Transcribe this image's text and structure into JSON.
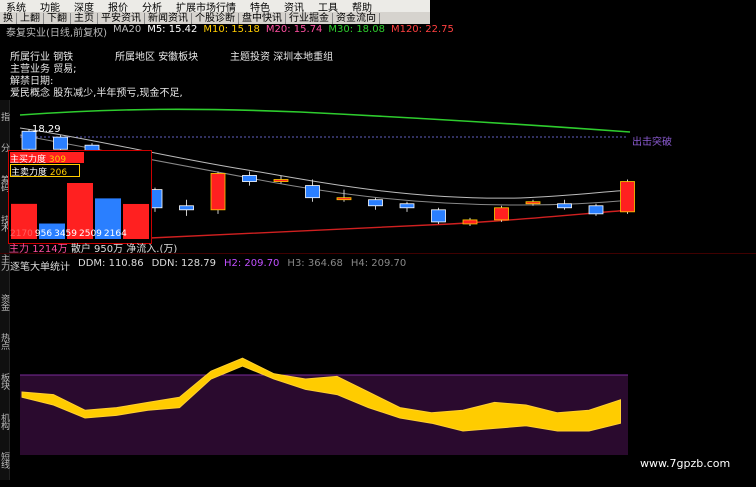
{
  "menu": [
    "系统",
    "功能",
    "深度",
    "报价",
    "分析",
    "扩展市场行情",
    "特色",
    "资讯",
    "工具",
    "帮助"
  ],
  "toolbar": [
    "换",
    "上翻",
    "下翻",
    "主页",
    "平安资讯",
    "新闻资讯",
    "个股诊断",
    "盘中快讯",
    "行业掘金",
    "资金流向"
  ],
  "header": {
    "stock": "泰复实业(日线,前复权)",
    "ma_label": "MA20",
    "m5": "M5: 15.42",
    "m10": "M10: 15.18",
    "m20": "M20: 15.74",
    "m30": "M30: 18.08",
    "m120": "M120: 22.75"
  },
  "stock_info": {
    "industry_label": "所属行业",
    "industry": "钢铁",
    "region_label": "所属地区",
    "region": "安徽板块",
    "theme_label": "主题投资",
    "theme": "深圳本地重组",
    "business_label": "主营业务",
    "business": "贸易;",
    "unlock_label": "解禁日期:",
    "concept_label": "爱民概念",
    "concept": "股东减少,半年预亏,现金不足,"
  },
  "price_label": "18.29",
  "signal_label": "出击突破",
  "force_panel": {
    "buy_label": "主买力度",
    "buy_value": "309",
    "sell_label": "主卖力度",
    "sell_value": "206",
    "bars": [
      "2170",
      "956",
      "3459",
      "2509",
      "2164"
    ],
    "bar_values": [
      2170,
      956,
      3459,
      2509,
      2164
    ],
    "main_label": "主力",
    "main_value": "1214万",
    "retail_label": "散户",
    "retail_value": "950万",
    "net_label": "净流入.(万)"
  },
  "indicator": {
    "name": "逐笔大单统计",
    "ddm": "DDM: 110.86",
    "ddn": "DDN: 128.79",
    "h2": "H2: 209.70",
    "h3": "H3: 364.68",
    "h4": "H4: 209.70"
  },
  "left_tabs": [
    "指",
    "分",
    "F10",
    "筹码",
    "技术",
    "财务",
    "主力",
    "资金",
    "热点",
    "板块",
    "机构",
    "短线",
    "主题"
  ],
  "watermark": "www.7gpzb.com",
  "colors": {
    "up": "#ff2020",
    "down": "#2a7fff",
    "yellow": "#ffcc00",
    "purple": "#2a0a2e",
    "green": "#2ecc2e"
  },
  "chart_data": {
    "type": "candlestick",
    "candles": [
      {
        "o": 17.4,
        "c": 18.29,
        "h": 18.4,
        "l": 17.2,
        "up": false
      },
      {
        "o": 18.0,
        "c": 17.4,
        "h": 18.1,
        "l": 17.2,
        "up": false
      },
      {
        "o": 17.6,
        "c": 16.5,
        "h": 17.7,
        "l": 16.4,
        "up": false
      },
      {
        "o": 16.8,
        "c": 15.6,
        "h": 16.9,
        "l": 15.4,
        "up": false
      },
      {
        "o": 15.4,
        "c": 14.5,
        "h": 15.5,
        "l": 14.3,
        "up": false
      },
      {
        "o": 14.6,
        "c": 14.4,
        "h": 14.9,
        "l": 14.1,
        "up": false
      },
      {
        "o": 14.4,
        "c": 16.2,
        "h": 16.3,
        "l": 14.2,
        "up": true
      },
      {
        "o": 16.1,
        "c": 15.8,
        "h": 16.3,
        "l": 15.6,
        "up": false
      },
      {
        "o": 15.8,
        "c": 15.9,
        "h": 16.1,
        "l": 15.7,
        "up": true
      },
      {
        "o": 15.6,
        "c": 15.0,
        "h": 15.9,
        "l": 14.8,
        "up": false
      },
      {
        "o": 14.9,
        "c": 15.0,
        "h": 15.4,
        "l": 14.8,
        "up": true
      },
      {
        "o": 14.9,
        "c": 14.6,
        "h": 15.0,
        "l": 14.4,
        "up": false
      },
      {
        "o": 14.7,
        "c": 14.5,
        "h": 14.8,
        "l": 14.3,
        "up": false
      },
      {
        "o": 14.4,
        "c": 13.8,
        "h": 14.5,
        "l": 13.7,
        "up": false
      },
      {
        "o": 13.9,
        "c": 13.7,
        "h": 14.0,
        "l": 13.6,
        "up": true
      },
      {
        "o": 13.9,
        "c": 14.5,
        "h": 14.6,
        "l": 13.8,
        "up": true
      },
      {
        "o": 14.7,
        "c": 14.8,
        "h": 14.9,
        "l": 14.6,
        "up": true
      },
      {
        "o": 14.7,
        "c": 14.5,
        "h": 14.9,
        "l": 14.4,
        "up": false
      },
      {
        "o": 14.6,
        "c": 14.2,
        "h": 14.7,
        "l": 14.1,
        "up": false
      },
      {
        "o": 14.3,
        "c": 15.8,
        "h": 15.9,
        "l": 14.2,
        "up": true
      }
    ],
    "lower_series": {
      "upper": [
        60,
        58,
        46,
        48,
        52,
        56,
        76,
        86,
        74,
        70,
        72,
        60,
        48,
        44,
        46,
        52,
        50,
        44,
        46,
        54
      ],
      "lower": [
        56,
        50,
        40,
        42,
        46,
        48,
        70,
        80,
        70,
        62,
        58,
        48,
        40,
        36,
        30,
        32,
        34,
        30,
        30,
        36
      ]
    }
  }
}
